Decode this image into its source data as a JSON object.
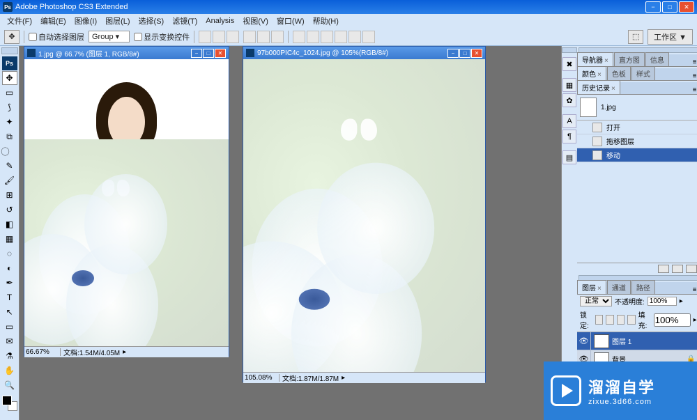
{
  "app": {
    "title": "Adobe Photoshop CS3 Extended",
    "icon_label": "Ps"
  },
  "menu": [
    "文件(F)",
    "编辑(E)",
    "图像(I)",
    "图层(L)",
    "选择(S)",
    "滤镜(T)",
    "Analysis",
    "视图(V)",
    "窗口(W)",
    "帮助(H)"
  ],
  "options": {
    "auto_select_label": "自动选择图层",
    "group_select": "Group",
    "show_transform_label": "显示变换控件",
    "workspace_label": "工作区 ▼"
  },
  "docs": [
    {
      "title": "1.jpg @ 66.7% (图层 1, RGB/8#)",
      "zoom": "66.67%",
      "doc_info": "文档:1.54M/4.05M"
    },
    {
      "title": "97b000PIC4c_1024.jpg @ 105%(RGB/8#)",
      "zoom": "105.08%",
      "doc_info": "文档:1.87M/1.87M"
    }
  ],
  "panels": {
    "nav_tabs": [
      "导航器",
      "直方图",
      "信息"
    ],
    "color_tabs": [
      "颜色",
      "色板",
      "样式"
    ],
    "history_tab": "历史记录",
    "history_doc": "1.jpg",
    "history_items": [
      {
        "label": "打开",
        "selected": false
      },
      {
        "label": "拖移图层",
        "selected": false
      },
      {
        "label": "移动",
        "selected": true
      }
    ],
    "layers_tabs": [
      "图层",
      "通道",
      "路径"
    ],
    "blend_mode": "正常",
    "opacity_label": "不透明度:",
    "opacity_value": "100%",
    "lock_label": "锁定:",
    "fill_label": "填充:",
    "fill_value": "100%",
    "layers": [
      {
        "name": "图层 1",
        "visible": true,
        "selected": true,
        "locked": false
      },
      {
        "name": "背景",
        "visible": true,
        "selected": false,
        "locked": true
      }
    ]
  },
  "watermark": {
    "big": "溜溜自学",
    "small": "zixue.3d66.com"
  }
}
